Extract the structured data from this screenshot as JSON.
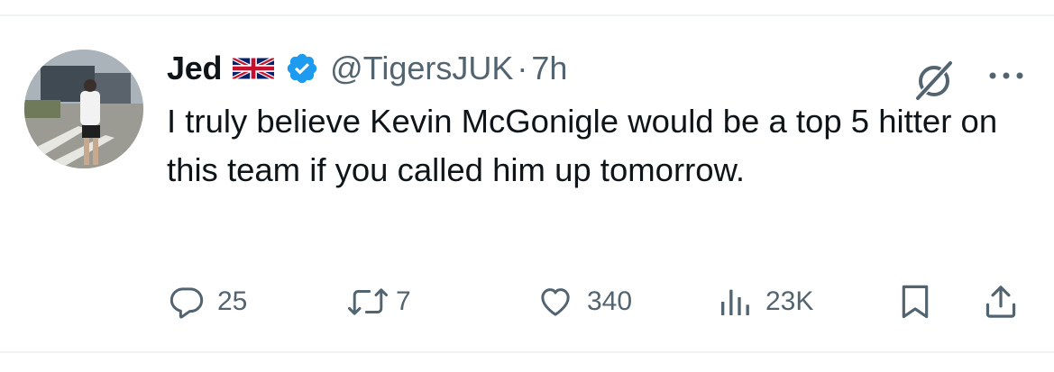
{
  "author": {
    "name": "Jed",
    "flag_icon": "uk-flag-icon",
    "verified_icon": "verified-badge-icon",
    "handle": "@TigersJUK",
    "separator": "·",
    "time": "7h"
  },
  "tweet": {
    "text": "I truly believe Kevin McGonigle would be a top 5 hitter on this team if you called him up tomorrow."
  },
  "actions": {
    "replies": "25",
    "retweets": "7",
    "likes": "340",
    "views": "23K"
  },
  "colors": {
    "text_primary": "#0f1419",
    "text_secondary": "#536471",
    "verified_blue": "#1d9bf0",
    "divider": "#eff3f4"
  }
}
